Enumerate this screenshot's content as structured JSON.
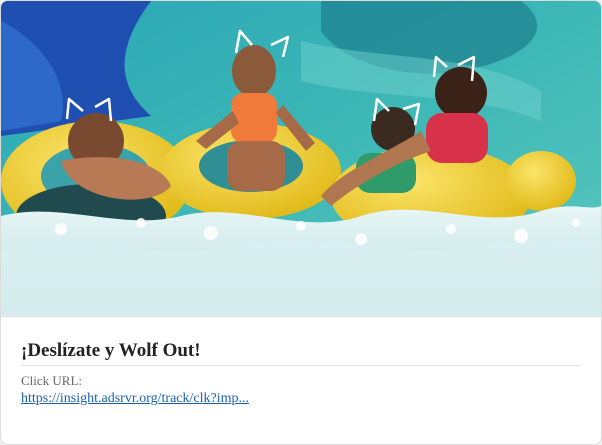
{
  "ad": {
    "image_description": "ad-image",
    "title": "¡Deslízate y Wolf Out!",
    "click_url_label": "Click URL:",
    "click_url_text": "https://insight.adsrvr.org/track/clk?imp..."
  },
  "colors": {
    "link": "#1a5fb4",
    "title": "#222222",
    "water": "#3fb0b5",
    "tube_yellow": "#f2cf2a"
  }
}
